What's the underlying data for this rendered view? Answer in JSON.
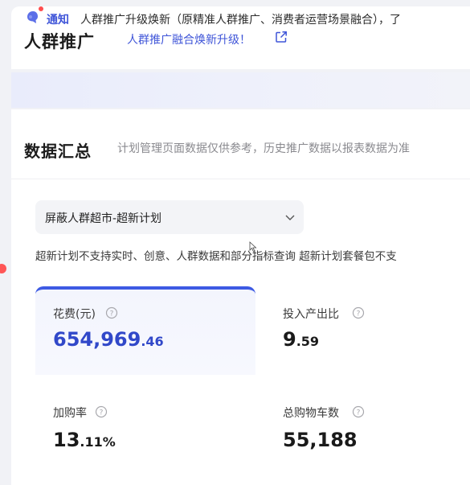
{
  "header": {
    "title": "人群推广",
    "upgrade_link": "人群推广融合焕新升级！"
  },
  "notice": {
    "label": "通知",
    "text": "人群推广升级焕新（原精准人群推广、消费者运营场景融合），了"
  },
  "summary": {
    "title": "数据汇总",
    "hint": "计划管理页面数据仅供参考，历史推广数据以报表数据为准"
  },
  "plan_select": {
    "value": "屏蔽人群超市-超新计划"
  },
  "unsupported_hint": "超新计划不支持实时、创意、人群数据和部分指标查询 超新计划套餐包不支",
  "metrics": [
    {
      "label": "花费(元)",
      "value_int": "654,969",
      "value_dec": ".46",
      "active": true
    },
    {
      "label": "投入产出比",
      "value_int": "9",
      "value_dec": ".59",
      "active": false
    },
    {
      "label": "加购率",
      "value_int": "13",
      "value_dec": ".11%",
      "active": false
    },
    {
      "label": "总购物车数",
      "value_int": "55,188",
      "value_dec": "",
      "active": false
    }
  ],
  "colors": {
    "accent": "#3d5ae3",
    "link": "#3f55d8",
    "notice_bg": "#e9ecfb",
    "alert_dot": "#ff4d4f"
  },
  "icons": {
    "external": "external-link-icon",
    "notice": "bell-icon",
    "select": "chevron-down-icon",
    "help": "question-circle-icon"
  }
}
